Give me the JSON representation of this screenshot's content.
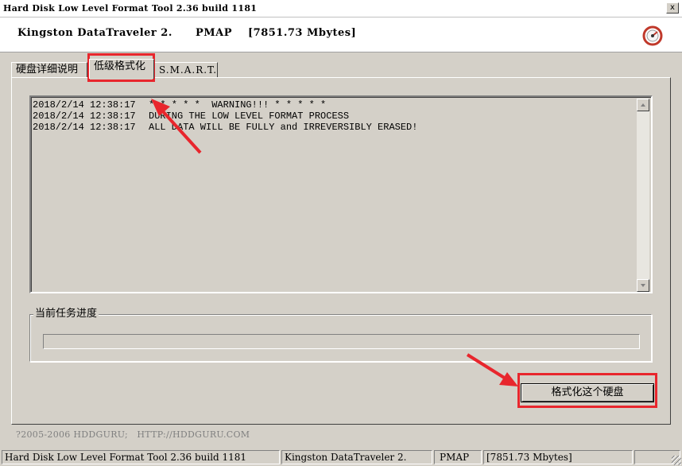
{
  "window": {
    "title": "Hard Disk Low Level Format Tool 2.36 build 1181",
    "close_label": "x"
  },
  "header": {
    "device": "Kingston DataTraveler 2.",
    "mode": "PMAP",
    "size": "[7851.73 Mbytes]"
  },
  "tabs": [
    {
      "label": "硬盘详细说明"
    },
    {
      "label": "低级格式化"
    },
    {
      "label": "S.M.A.R.T."
    }
  ],
  "log": [
    {
      "time": "2018/2/14 12:38:17",
      "message": "* * * * *  WARNING!!! * * * * *"
    },
    {
      "time": "2018/2/14 12:38:17",
      "message": "DURING THE LOW LEVEL FORMAT PROCESS"
    },
    {
      "time": "2018/2/14 12:38:17",
      "message": "ALL DATA WILL BE FULLY and IRREVERSIBLY ERASED!"
    }
  ],
  "progress": {
    "label": "当前任务进度",
    "percent": 0
  },
  "format_button": "格式化这个硬盘",
  "copyright": "?2005-2006 HDDGURU;   HTTP://HDDGURU.COM",
  "statusbar": {
    "app": "Hard Disk Low Level Format Tool 2.36 build 1181",
    "device": "Kingston DataTraveler 2.",
    "mode": "PMAP",
    "size": "[7851.73 Mbytes]"
  },
  "icons": {
    "app": "gauge-icon",
    "close": "close-icon",
    "scroll_up": "arrow-up-icon",
    "scroll_down": "arrow-down-icon"
  },
  "colors": {
    "annotation": "#e8262d",
    "window": "#d4d0c8"
  }
}
